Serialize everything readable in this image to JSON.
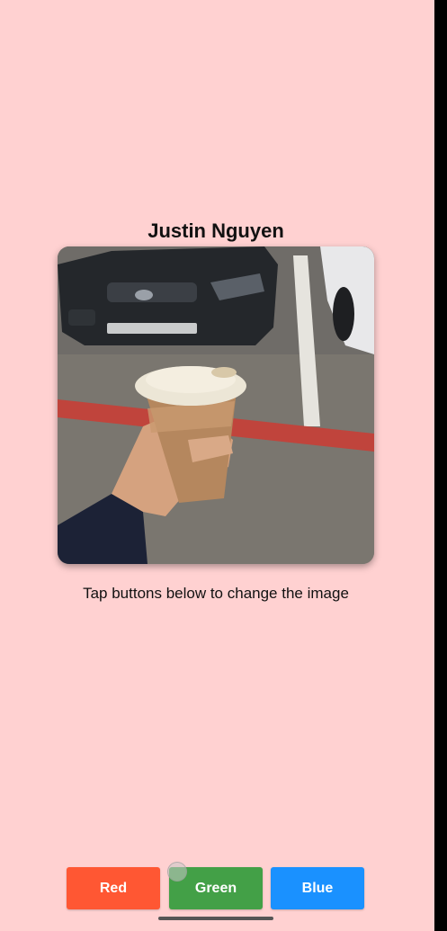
{
  "profile": {
    "name": "Justin Nguyen",
    "photo_alt": "Hand holding iced coffee in parking lot"
  },
  "caption": "Tap buttons below to change the image",
  "buttons": {
    "red": "Red",
    "green": "Green",
    "blue": "Blue"
  },
  "colors": {
    "background": "#ffd1d1",
    "red_button": "#ff5733",
    "green_button": "#43a047",
    "blue_button": "#1a91ff"
  }
}
